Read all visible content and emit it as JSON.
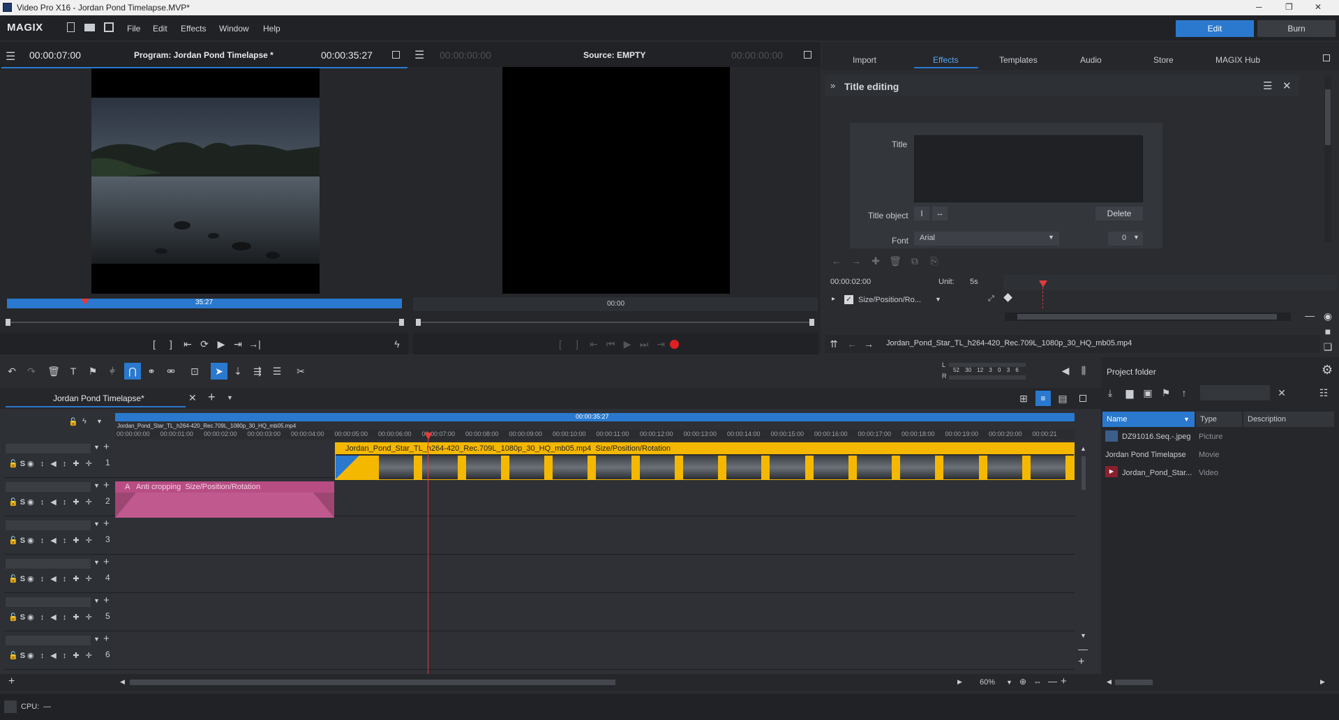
{
  "window": {
    "title": "Video Pro X16 - Jordan Pond Timelapse.MVP*"
  },
  "menu": {
    "logo": "MAGIX",
    "items": [
      "File",
      "Edit",
      "Effects",
      "Window",
      "Help"
    ],
    "edit_label": "Edit",
    "burn_label": "Burn"
  },
  "program_monitor": {
    "position": "00:00:07:00",
    "title": "Program: Jordan Pond Timelapse *",
    "duration": "00:00:35:27",
    "scrub_label": "35:27"
  },
  "source_monitor": {
    "position": "00:00:00:00",
    "title": "Source: EMPTY",
    "duration": "00:00:00:00",
    "scrub_label": "00:00"
  },
  "media_pool": {
    "tabs": [
      "Import",
      "Effects",
      "Templates",
      "Audio",
      "Store",
      "MAGIX Hub"
    ],
    "active_tab": "Effects",
    "title_editing": {
      "header": "Title editing",
      "title_label": "Title",
      "title_object_label": "Title object",
      "delete_label": "Delete",
      "font_label": "Font",
      "font_value": "Arial",
      "font_size": "0"
    }
  },
  "keyframes": {
    "time": "00:00:02:00",
    "unit_label": "Unit:",
    "unit_value": "5s",
    "effect_label": "Size/Position/Ro...",
    "clip_name": "Jordan_Pond_Star_TL_h264-420_Rec.709L_1080p_30_HQ_mb05.mp4"
  },
  "meter": {
    "l": "L",
    "r": "R",
    "scale": "52 30 12 3 0 3 6"
  },
  "timeline": {
    "tab": "Jordan Pond Timelapse*",
    "duration": "00:00:35:27",
    "marker_label": "Jordan_Pond_Star_TL_h264-420_Rec.709L_1080p_30_HQ_mb05.mp4",
    "ruler": [
      "00:00:00:00",
      "00:00:01:00",
      "00:00:02:00",
      "00:00:03:00",
      "00:00:04:00",
      "00:00:05:00",
      "00:00:06:00",
      "00:00:07:00",
      "00:00:08:00",
      "00:00:09:00",
      "00:00:10:00",
      "00:00:11:00",
      "00:00:12:00",
      "00:00:13:00",
      "00:00:14:00",
      "00:00:15:00",
      "00:00:16:00",
      "00:00:17:00",
      "00:00:18:00",
      "00:00:19:00",
      "00:00:20:00",
      "00:00:21"
    ],
    "tracks": [
      "1",
      "2",
      "3",
      "4",
      "5",
      "6"
    ],
    "track_controls": "S",
    "clip1": "Jordan_Pond_Star_TL_h264-420_Rec.709L_1080p_30_HQ_mb05.mp4  Size/Position/Rotation",
    "clip2_tag": "A",
    "clip2": "Anti cropping  Size/Position/Rotation",
    "zoom": "60%"
  },
  "project_folder": {
    "title": "Project folder",
    "columns": [
      "Name",
      "Type",
      "Description"
    ],
    "items": [
      {
        "name": "DZ91016.Seq.-.jpeg",
        "type": "Picture"
      },
      {
        "name": "Jordan Pond Timelapse",
        "type": "Movie"
      },
      {
        "name": "Jordan_Pond_Star...",
        "type": "Video"
      }
    ]
  },
  "status": {
    "cpu": "CPU:",
    "cpu_value": "—"
  },
  "colors": {
    "accent": "#2a79cf",
    "clip_yellow": "#f5b800",
    "clip_pink": "#b84d84",
    "playhead": "#e23b3b"
  }
}
